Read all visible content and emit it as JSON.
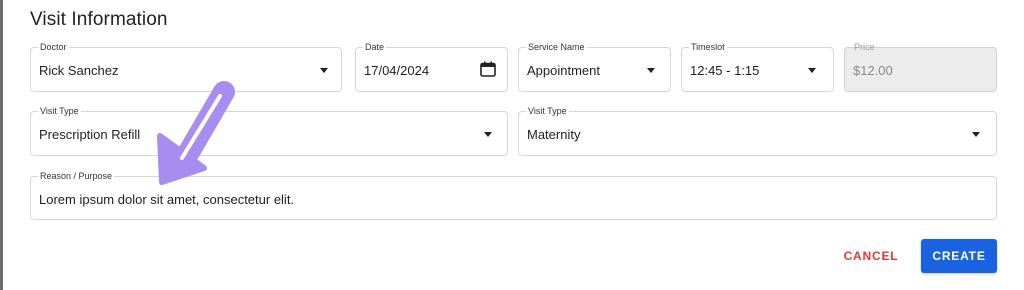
{
  "dialog": {
    "title": "Visit Information"
  },
  "fields": {
    "doctor": {
      "label": "Doctor",
      "value": "Rick Sanchez"
    },
    "date": {
      "label": "Date",
      "value": "17/04/2024"
    },
    "service_name": {
      "label": "Service Name",
      "value": "Appointment"
    },
    "timeslot": {
      "label": "Timeslot",
      "value": "12:45 - 1:15"
    },
    "price": {
      "label": "Price",
      "value": "$12.00"
    },
    "visit_type_1": {
      "label": "Visit Type",
      "value": "Prescription Refill"
    },
    "visit_type_2": {
      "label": "Visit Type",
      "value": "Maternity"
    },
    "reason": {
      "label": "Reason / Purpose",
      "value": "Lorem ipsum dolor sit amet, consectetur elit."
    }
  },
  "actions": {
    "cancel_label": "CANCEL",
    "create_label": "CREATE"
  },
  "icons": {
    "dropdown": "chevron-down-icon",
    "date": "calendar-icon",
    "annotation": "annotation-arrow-icon"
  },
  "colors": {
    "primary": "#1a63e0",
    "danger": "#e53935",
    "annotation": "#a98cf0"
  }
}
